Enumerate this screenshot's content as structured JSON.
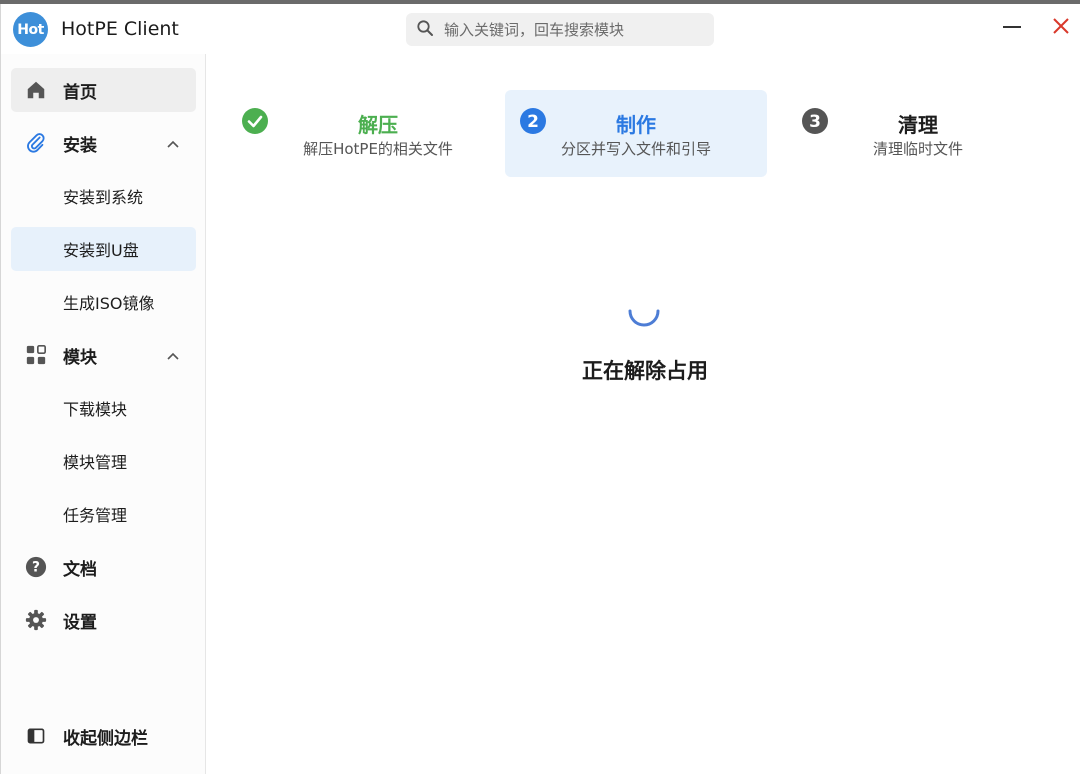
{
  "app": {
    "logo_text": "Hot",
    "title": "HotPE Client",
    "accent": "#2b79e2",
    "brand": "#3d8fd9"
  },
  "search": {
    "placeholder": "输入关键词，回车搜索模块",
    "icon": "search-icon"
  },
  "window_controls": {
    "minimize_icon": "minimize-icon",
    "close_icon": "close-icon",
    "close_color": "#d9382b"
  },
  "sidebar": {
    "items": [
      {
        "label": "首页",
        "icon": "home-icon",
        "selected": true
      },
      {
        "label": "安装",
        "icon": "paperclip-icon",
        "expanded": true
      },
      {
        "label": "安装到系统",
        "sub": true
      },
      {
        "label": "安装到U盘",
        "sub": true,
        "selected": true
      },
      {
        "label": "生成ISO镜像",
        "sub": true
      },
      {
        "label": "模块",
        "icon": "apps-icon",
        "expanded": true
      },
      {
        "label": "下载模块",
        "sub": true
      },
      {
        "label": "模块管理",
        "sub": true
      },
      {
        "label": "任务管理",
        "sub": true
      },
      {
        "label": "文档",
        "icon": "help-icon"
      },
      {
        "label": "设置",
        "icon": "gear-icon"
      }
    ],
    "collapse_label": "收起侧边栏"
  },
  "steps": [
    {
      "number": "",
      "title": "解压",
      "subtitle": "解压HotPE的相关文件",
      "state": "done",
      "color": "#4caf50"
    },
    {
      "number": "2",
      "title": "制作",
      "subtitle": "分区并写入文件和引导",
      "state": "active",
      "color": "#2b79e2"
    },
    {
      "number": "3",
      "title": "清理",
      "subtitle": "清理临时文件",
      "state": "pending",
      "color": "#555555"
    }
  ],
  "status": {
    "text": "正在解除占用"
  }
}
